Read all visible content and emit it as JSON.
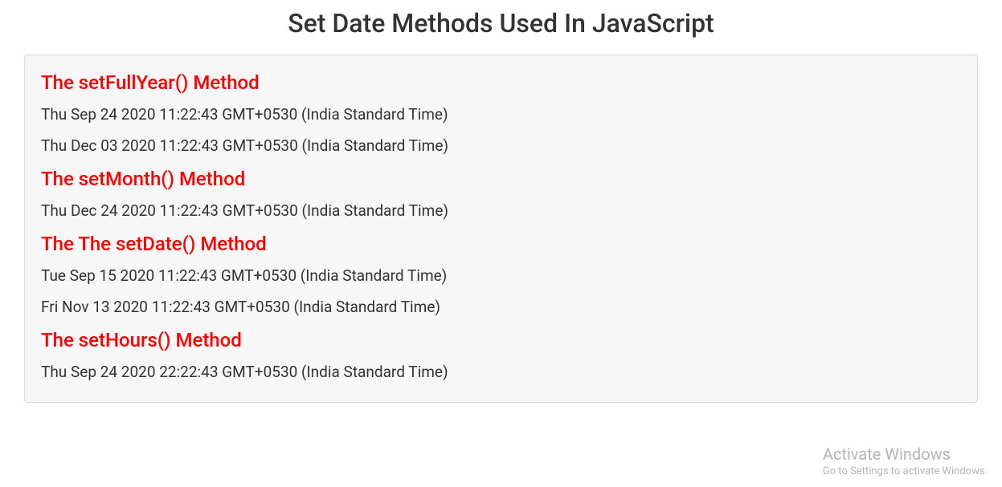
{
  "title": "Set Date Methods Used In JavaScript",
  "sections": [
    {
      "heading": "The setFullYear() Method",
      "lines": [
        "Thu Sep 24 2020 11:22:43 GMT+0530 (India Standard Time)",
        "Thu Dec 03 2020 11:22:43 GMT+0530 (India Standard Time)"
      ]
    },
    {
      "heading": "The setMonth() Method",
      "lines": [
        "Thu Dec 24 2020 11:22:43 GMT+0530 (India Standard Time)"
      ]
    },
    {
      "heading": "The The setDate() Method",
      "lines": [
        "Tue Sep 15 2020 11:22:43 GMT+0530 (India Standard Time)",
        "Fri Nov 13 2020 11:22:43 GMT+0530 (India Standard Time)"
      ]
    },
    {
      "heading": "The setHours() Method",
      "lines": [
        "Thu Sep 24 2020 22:22:43 GMT+0530 (India Standard Time)"
      ]
    }
  ],
  "watermark": {
    "title": "Activate Windows",
    "subtitle": "Go to Settings to activate Windows."
  }
}
